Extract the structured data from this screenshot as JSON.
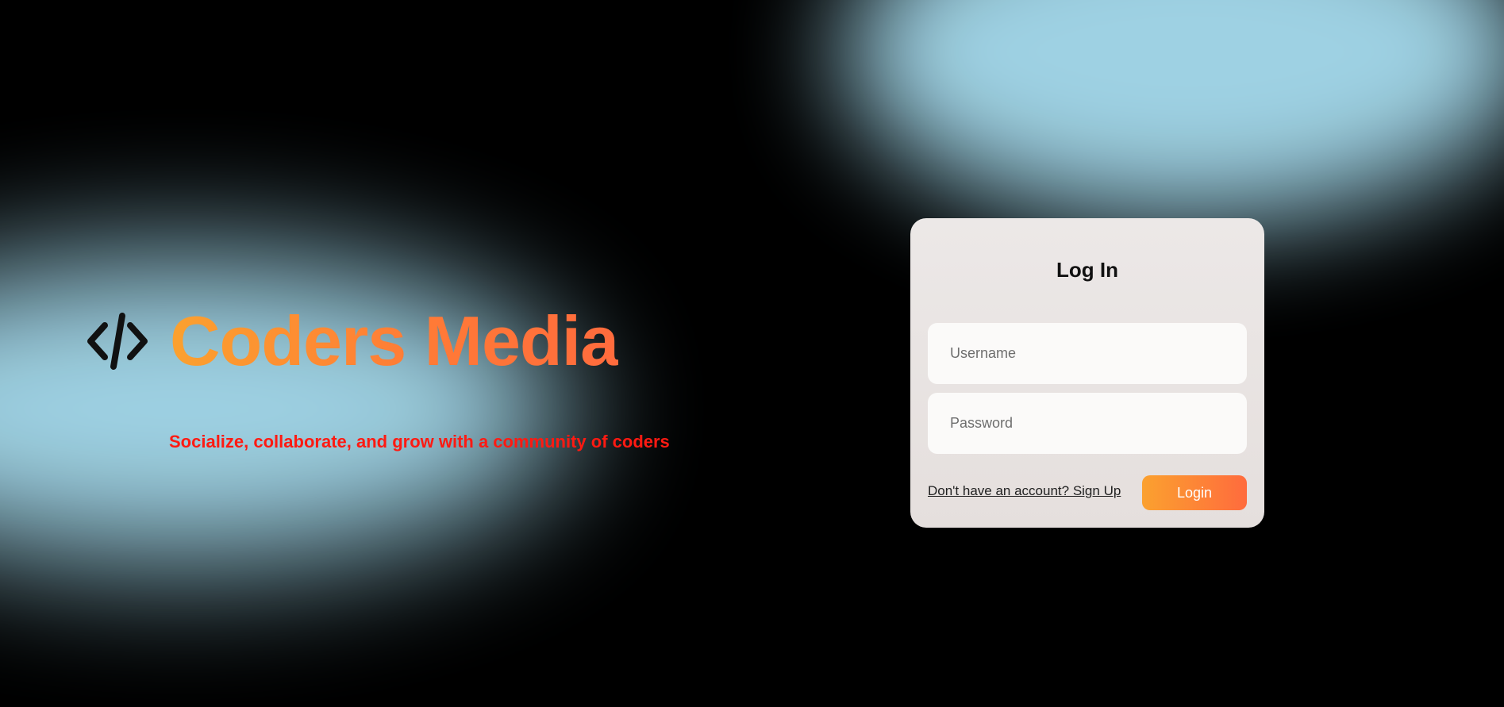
{
  "brand": {
    "icon": "code-icon",
    "title": "Coders Media",
    "tagline": "Socialize, collaborate, and grow with a community of coders"
  },
  "login": {
    "title": "Log In",
    "username_placeholder": "Username",
    "password_placeholder": "Password",
    "signup_text": "Don't have an account? Sign Up",
    "submit_label": "Login"
  },
  "colors": {
    "background": "#000000",
    "glow": "#a2d6e8",
    "accent_start": "#fba12f",
    "accent_end": "#ff6b3d",
    "tagline": "#ff1a12",
    "card": "#e9e4e2"
  }
}
